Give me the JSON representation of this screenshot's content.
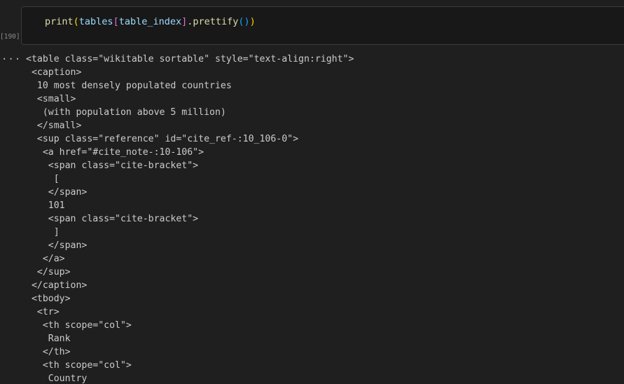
{
  "cell": {
    "execution_count": "[190]",
    "code_tokens": {
      "fn": "print",
      "open1": "(",
      "arg_var": "tables",
      "open2": "[",
      "index_var": "table_index",
      "close2": "]",
      "method": ".prettify",
      "open3": "()",
      "close1": ")"
    }
  },
  "output": {
    "more_label": "...",
    "lines": [
      "<table class=\"wikitable sortable\" style=\"text-align:right\">",
      " <caption>",
      "  10 most densely populated countries",
      "  <small>",
      "   (with population above 5 million)",
      "  </small>",
      "  <sup class=\"reference\" id=\"cite_ref-:10_106-0\">",
      "   <a href=\"#cite_note-:10-106\">",
      "    <span class=\"cite-bracket\">",
      "     [",
      "    </span>",
      "    101",
      "    <span class=\"cite-bracket\">",
      "     ]",
      "    </span>",
      "   </a>",
      "  </sup>",
      " </caption>",
      " <tbody>",
      "  <tr>",
      "   <th scope=\"col\">",
      "    Rank",
      "   </th>",
      "   <th scope=\"col\">",
      "    Country"
    ]
  }
}
